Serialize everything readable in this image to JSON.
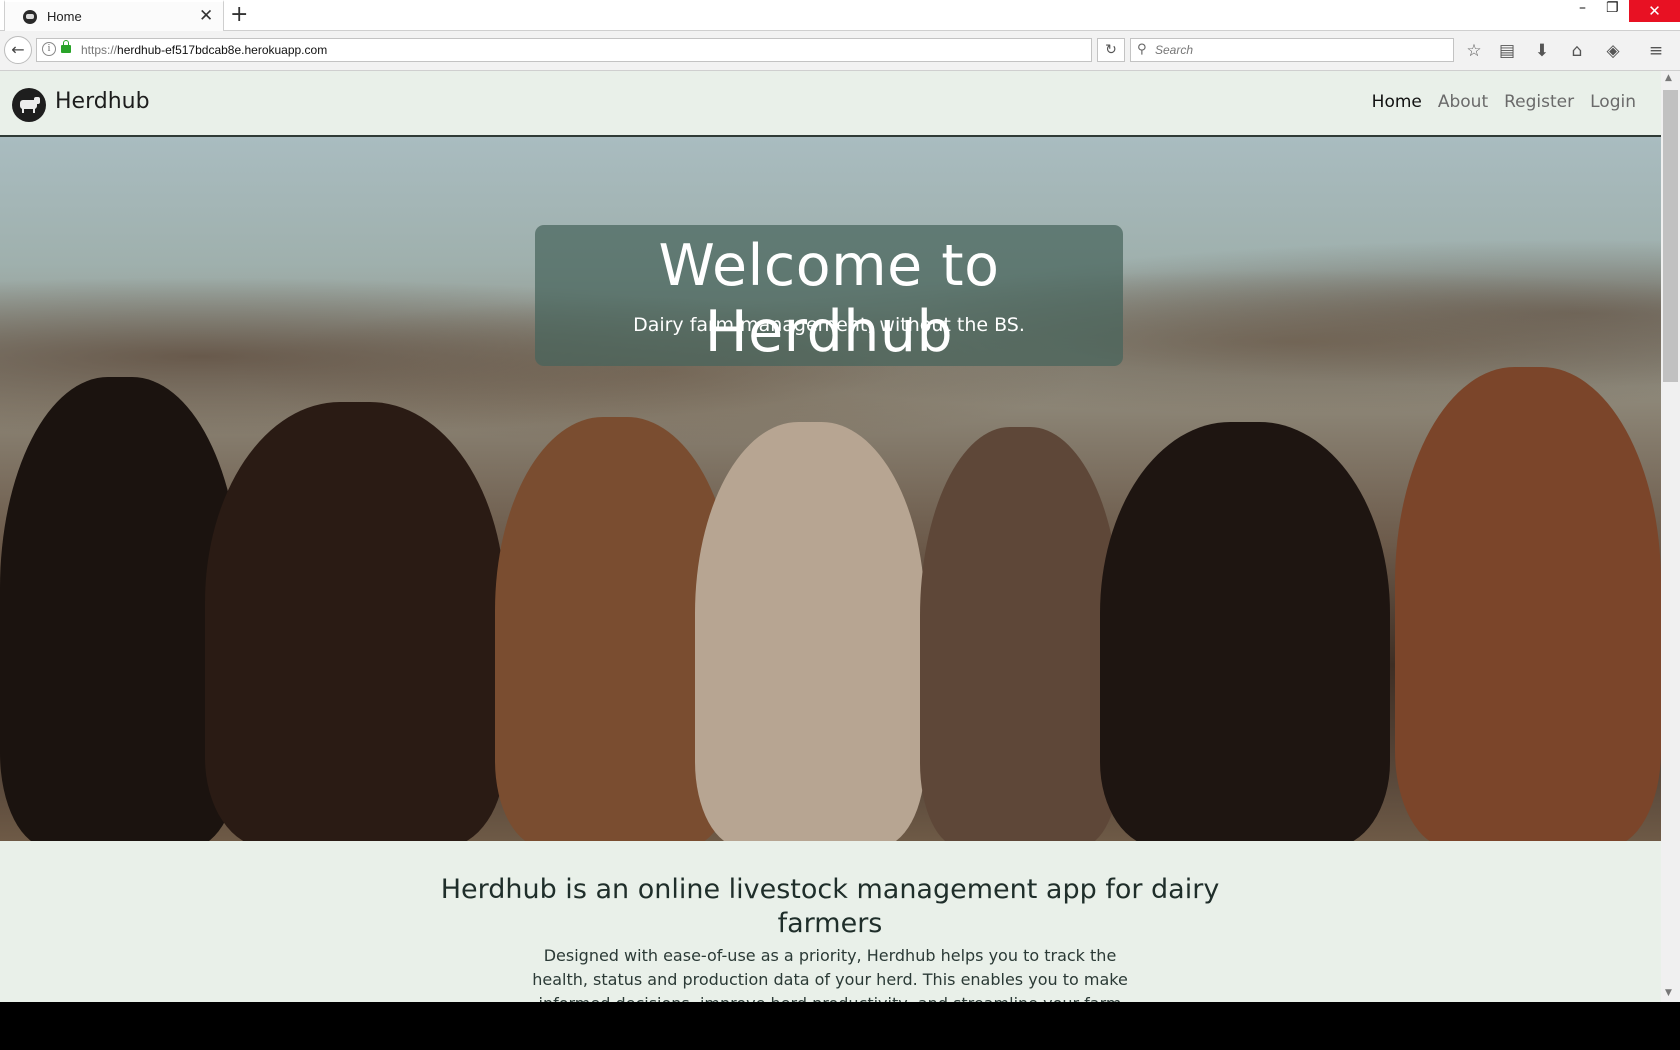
{
  "browser": {
    "tab_title": "Home",
    "tab_close": "✕",
    "new_tab": "+",
    "url_prefix": "https://",
    "url_host": "herdhub-ef517bdcab8e.herokuapp.com",
    "search_placeholder": "Search",
    "window": {
      "minimize": "–",
      "maximize": "❐",
      "close": "✕"
    }
  },
  "site": {
    "brand": "Herdhub",
    "nav": [
      {
        "label": "Home",
        "active": true
      },
      {
        "label": "About",
        "active": false
      },
      {
        "label": "Register",
        "active": false
      },
      {
        "label": "Login",
        "active": false
      }
    ]
  },
  "hero": {
    "title": "Welcome to Herdhub",
    "subtitle": "Dairy farm management, without the BS."
  },
  "about": {
    "heading": "Herdhub is an online livestock management app for dairy farmers",
    "body": "Designed with ease-of-use as a priority, Herdhub helps you to track the health, status and production data of your herd. This enables you to make informed decisions, improve herd productivity, and streamline your farm"
  },
  "colors": {
    "page_background": "#e9f0e9",
    "hero_card": "#46645c",
    "nav_active": "#111111",
    "nav_inactive": "#6a6a6a"
  }
}
